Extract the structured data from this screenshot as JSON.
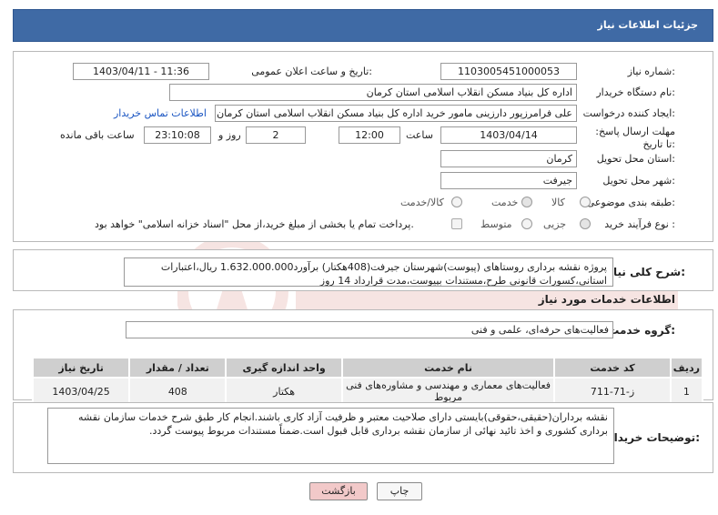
{
  "header": {
    "title": "جزئیات اطلاعات نیاز"
  },
  "form": {
    "need_number": {
      "label": "شماره نیاز:",
      "value": "1103005451000053"
    },
    "announce_datetime": {
      "label": "تاریخ و ساعت اعلان عمومی:",
      "value": "1403/04/11 - 11:36"
    },
    "buyer_org": {
      "label": "نام دستگاه خریدار:",
      "value": "اداره کل بنیاد مسکن انقلاب اسلامی استان کرمان"
    },
    "requester": {
      "label": "ایجاد کننده درخواست:",
      "value": "علی فرامرزپور دارزینی مامور خرید اداره کل بنیاد مسکن انقلاب اسلامی استان کرمان",
      "contact_link": "اطلاعات تماس خریدار"
    },
    "deadline": {
      "label": "مهلت ارسال پاسخ: تا تاریخ:",
      "date": "1403/04/14",
      "time_label": "ساعت",
      "time": "12:00",
      "days": "2",
      "days_label": "روز و",
      "remaining": "23:10:08",
      "remaining_label": "ساعت باقی مانده"
    },
    "province": {
      "label": "استان محل تحویل:",
      "value": "کرمان"
    },
    "city": {
      "label": "شهر محل تحویل:",
      "value": "جیرفت"
    },
    "category": {
      "label": "طبقه بندی موضوعی:",
      "options": [
        "کالا",
        "خدمت",
        "کالا/خدمت"
      ]
    },
    "purchase_type": {
      "label": "نوع فرآیند خرید :",
      "options": [
        "جزیی",
        "متوسط"
      ],
      "note": "پرداخت تمام یا بخشی از مبلغ خرید،از محل \"اسناد خزانه اسلامی\" خواهد بود."
    }
  },
  "summary": {
    "label": "شرح کلی نیاز:",
    "text": "پروژه نقشه برداری روستاهای (پیوست)شهرستان جیرفت(408هکتار) برآورد1.632.000.000 ریال،اعتبارات استانی،کسورات قانونی طرح،مستندات بپیوست،مدت قرارداد 14 روز"
  },
  "services": {
    "section_title": "اطلاعات خدمات مورد نیاز",
    "group_label": "گروه خدمت:",
    "group_value": "فعالیت‌های حرفه‌ای، علمی و فنی",
    "columns": [
      "ردیف",
      "کد خدمت",
      "نام خدمت",
      "واحد اندازه گیری",
      "تعداد / مقدار",
      "تاریخ نیاز"
    ],
    "rows": [
      {
        "row": "1",
        "code": "ز-71-711",
        "name": "فعالیت‌های معماری و مهندسی و مشاوره‌های فنی مربوط",
        "unit": "هکتار",
        "qty": "408",
        "date": "1403/04/25"
      }
    ]
  },
  "buyer_notes": {
    "label": "توضیحات خریدار:",
    "text": "نقشه برداران(حقیقی،حقوقی)بایستی دارای صلاحیت معتبر و ظرفیت آزاد کاری باشند.انجام کار طبق شرح خدمات سازمان نقشه برداری کشوری و اخذ تائید نهائی از سازمان نقشه برداری قابل قبول است.ضمناً مستندات مربوط پیوست گردد."
  },
  "buttons": {
    "print": "چاپ",
    "back": "بازگشت"
  },
  "colors": {
    "header_bg": "#3f6aa5",
    "back_btn_bg": "#f2c9c9",
    "table_header_bg": "#cfcfcf"
  }
}
